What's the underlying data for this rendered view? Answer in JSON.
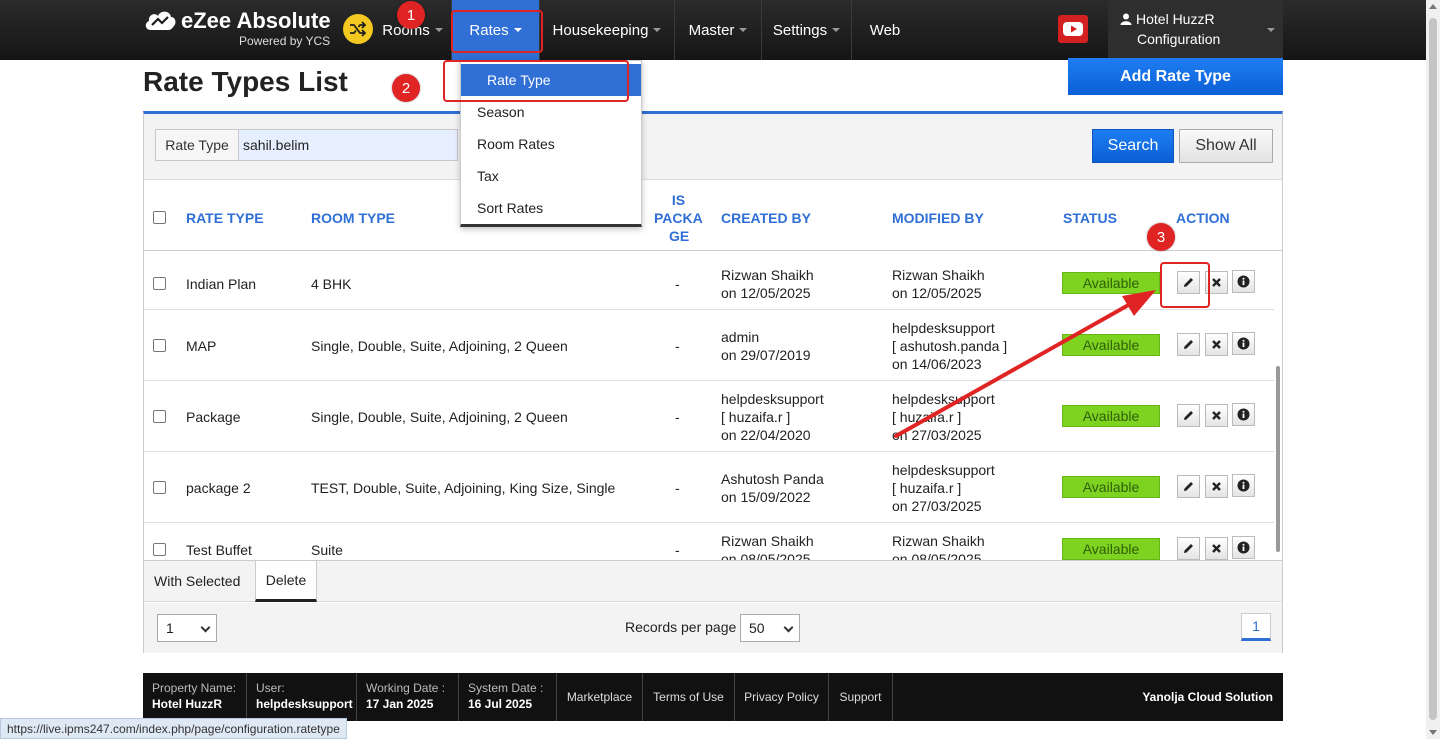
{
  "brand": {
    "title": "eZee Absolute",
    "subtitle": "Powered by YCS"
  },
  "nav": {
    "items": [
      {
        "label": "Rooms"
      },
      {
        "label": "Rates"
      },
      {
        "label": "Housekeeping"
      },
      {
        "label": "Master"
      },
      {
        "label": "Settings"
      },
      {
        "label": "Web"
      }
    ],
    "hotel_line1": "Hotel HuzzR",
    "hotel_line2": "Configuration"
  },
  "rates_menu": {
    "items": [
      "Rate Type",
      "Season",
      "Room Rates",
      "Tax",
      "Sort Rates"
    ]
  },
  "annotations": [
    "1",
    "2",
    "3"
  ],
  "page": {
    "title": "Rate Types List",
    "add_button": "Add Rate Type"
  },
  "filter": {
    "label": "Rate Type",
    "value": "sahil.belim",
    "search_button": "Search",
    "show_all_button": "Show All"
  },
  "table": {
    "headers": {
      "rate_type": "RATE TYPE",
      "room_type": "ROOM TYPE",
      "is_package_1": "IS",
      "is_package_2": "PACKA",
      "is_package_3": "GE",
      "created_by": "CREATED BY",
      "modified_by": "MODIFIED BY",
      "status": "STATUS",
      "action": "ACTION"
    },
    "rows": [
      {
        "rate_type": "Indian Plan",
        "room_type": "4 BHK",
        "is_package": "-",
        "created_1": "Rizwan Shaikh",
        "created_2": "on 12/05/2025",
        "modified_1": "Rizwan Shaikh",
        "modified_2": "on 12/05/2025",
        "modified_3": "",
        "status": "Available"
      },
      {
        "rate_type": "MAP",
        "room_type": "Single, Double, Suite, Adjoining, 2 Queen",
        "is_package": "-",
        "created_1": "admin",
        "created_2": "on 29/07/2019",
        "modified_1": "helpdesksupport",
        "modified_2": "[ ashutosh.panda ]",
        "modified_3": "on 14/06/2023",
        "status": "Available"
      },
      {
        "rate_type": "Package",
        "room_type": "Single, Double, Suite, Adjoining, 2 Queen",
        "is_package": "-",
        "created_1": "helpdesksupport",
        "created_2": "[ huzaifa.r ]",
        "created_3": "on 22/04/2020",
        "modified_1": "helpdesksupport",
        "modified_2": "[ huzaifa.r ]",
        "modified_3": "on 27/03/2025",
        "status": "Available"
      },
      {
        "rate_type": "package 2",
        "room_type": "TEST, Double, Suite, Adjoining, King Size, Single",
        "is_package": "-",
        "created_1": "Ashutosh Panda",
        "created_2": "on 15/09/2022",
        "modified_1": "helpdesksupport",
        "modified_2": "[ huzaifa.r ]",
        "modified_3": "on 27/03/2025",
        "status": "Available"
      },
      {
        "rate_type": "Test Buffet",
        "room_type": "Suite",
        "is_package": "-",
        "created_1": "Rizwan Shaikh",
        "created_2": "on 08/05/2025",
        "modified_1": "Rizwan Shaikh",
        "modified_2": "on 08/05/2025",
        "modified_3": "",
        "status": "Available"
      }
    ]
  },
  "bulk": {
    "label": "With Selected",
    "delete_button": "Delete"
  },
  "pager": {
    "page_select": "1",
    "records_label": "Records per page",
    "records_value": "50",
    "current_page": "1"
  },
  "footer": {
    "property_label": "Property Name:",
    "property_value": "Hotel HuzzR",
    "user_label": "User:",
    "user_value": "helpdesksupport",
    "working_label": "Working Date :",
    "working_value": "17 Jan 2025",
    "system_label": "System Date :",
    "system_value": "16 Jul 2025",
    "links": [
      "Marketplace",
      "Terms of Use",
      "Privacy Policy",
      "Support"
    ],
    "brand": "Yanolja Cloud Solution"
  },
  "status_url": "https://live.ipms247.com/index.php/page/configuration.ratetype",
  "colors": {
    "accent": "#2f6fd6",
    "available": "#7ed321",
    "annotation": "#e02424",
    "topbar": "#1b1b1b"
  },
  "icons": [
    "cloud-logo-icon",
    "shuffle-icon",
    "youtube-icon",
    "user-icon",
    "edit-pencil-icon",
    "delete-x-icon",
    "info-icon"
  ]
}
